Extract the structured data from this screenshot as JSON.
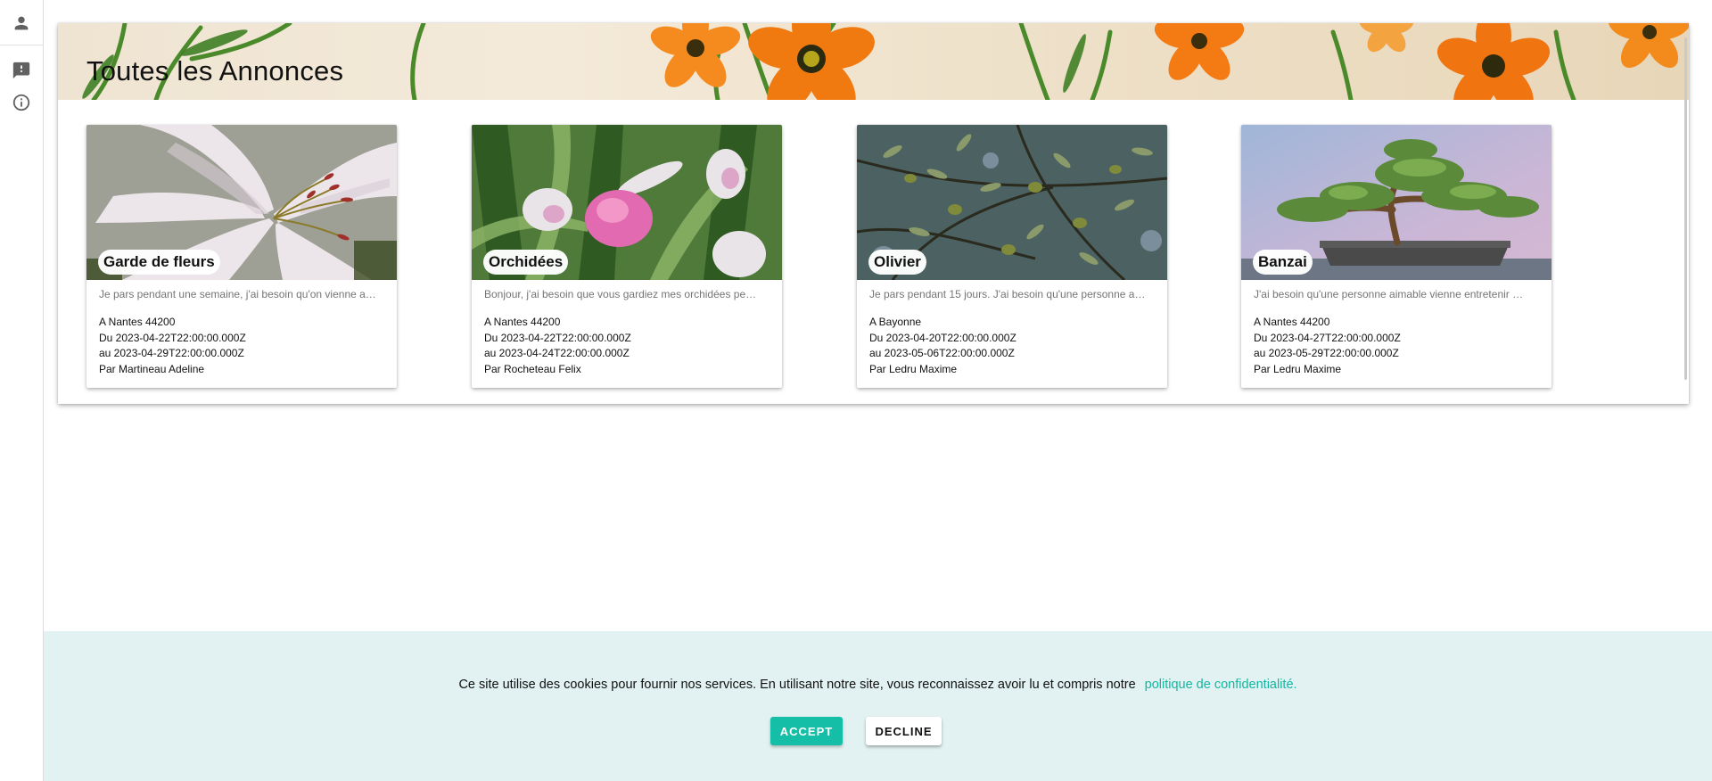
{
  "rail": {
    "items": [
      {
        "icon": "person-icon"
      },
      {
        "icon": "feedback-icon"
      },
      {
        "icon": "info-icon"
      }
    ]
  },
  "page": {
    "title": "Toutes les Annonces"
  },
  "cards": [
    {
      "title": "Garde de fleurs",
      "description": "Je pars pendant une semaine, j'ai besoin qu'on vienne a…",
      "location": "A Nantes 44200",
      "from": "Du 2023-04-22T22:00:00.000Z",
      "to": "au 2023-04-29T22:00:00.000Z",
      "author": "Par Martineau Adeline"
    },
    {
      "title": "Orchidées",
      "description": "Bonjour, j'ai besoin que vous gardiez mes orchidées pe…",
      "location": "A Nantes 44200",
      "from": "Du 2023-04-22T22:00:00.000Z",
      "to": "au 2023-04-24T22:00:00.000Z",
      "author": "Par Rocheteau Felix"
    },
    {
      "title": "Olivier",
      "description": "Je pars pendant 15 jours. J'ai besoin qu'une personne a…",
      "location": "A Bayonne",
      "from": "Du 2023-04-20T22:00:00.000Z",
      "to": "au 2023-05-06T22:00:00.000Z",
      "author": "Par Ledru Maxime"
    },
    {
      "title": "Banzai",
      "description": "J'ai besoin qu'une personne aimable vienne entretenir …",
      "location": "A Nantes 44200",
      "from": "Du 2023-04-27T22:00:00.000Z",
      "to": "au 2023-05-29T22:00:00.000Z",
      "author": "Par Ledru Maxime"
    }
  ],
  "cookie": {
    "text": "Ce site utilise des cookies pour fournir nos services. En utilisant notre site, vous reconnaissez avoir lu et compris notre",
    "link": "politique de confidentialité.",
    "accept": "ACCEPT",
    "decline": "DECLINE"
  },
  "colors": {
    "accent": "#15bea6",
    "cookie_bg": "#e2f1f1",
    "link": "#14b7a0"
  }
}
